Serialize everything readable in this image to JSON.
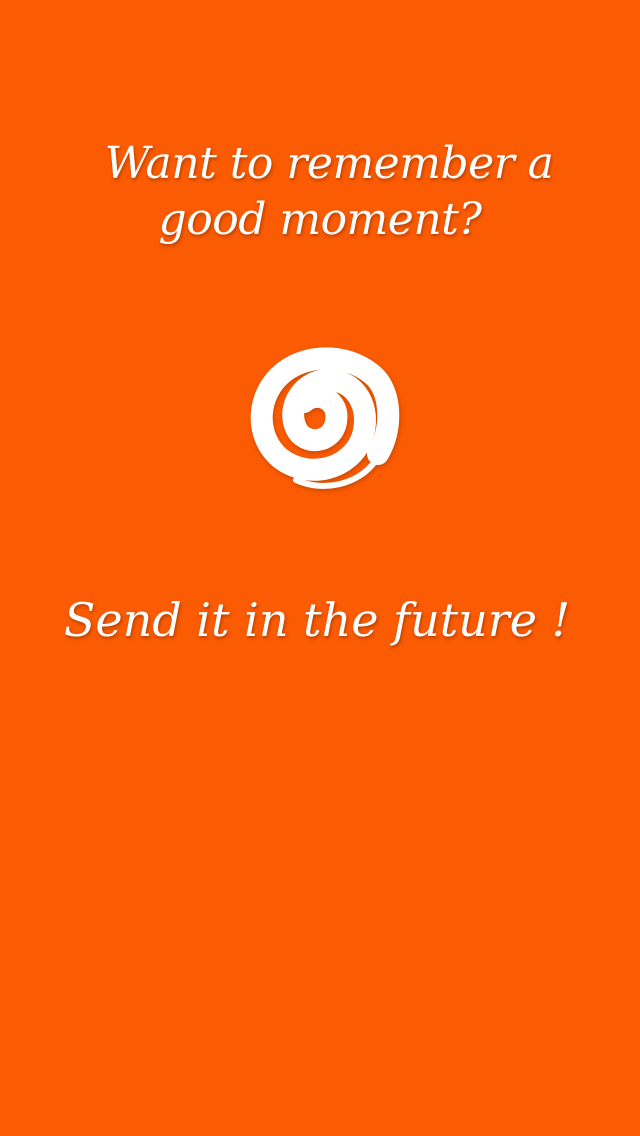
{
  "onboarding": {
    "headline_line1": "Want to remember a",
    "headline_line2": "good moment?",
    "logo_icon": "spiral-icon",
    "tagline": "Send it in the future !"
  },
  "colors": {
    "background": "#FB5B03",
    "text": "#FFFFFF"
  }
}
